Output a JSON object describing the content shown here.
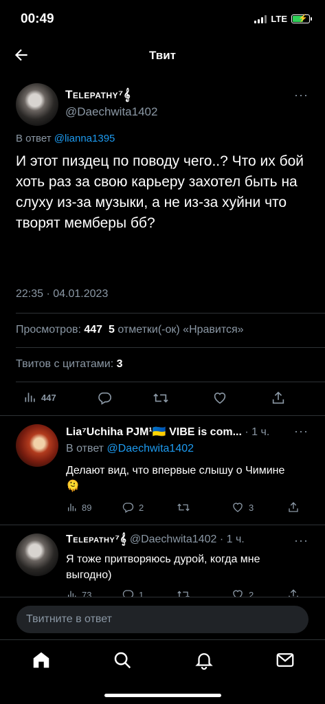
{
  "status_bar": {
    "time": "00:49",
    "network": "LTE"
  },
  "nav": {
    "title": "Твит"
  },
  "tweet": {
    "author_name": "Telepathy⁷𝄞",
    "author_handle": "@Daechwita1402",
    "reply_prefix": "В ответ",
    "reply_to": "@lianna1395",
    "text": "И этот пиздец по поводу чего..? Что их бой хоть раз за свою карьеру захотел быть на слуху из-за музыки, а не из-за хуйни что творят мемберы бб?",
    "timestamp": "22:35 · 04.01.2023",
    "views_label": "Просмотров:",
    "views_count": "447",
    "likes_count": "5",
    "likes_label": "отметки(-ок) «Нравится»",
    "quotes_label": "Твитов с цитатами:",
    "quotes_count": "3",
    "actions": {
      "views": "447"
    }
  },
  "replies": [
    {
      "author_name": "Lia⁷Uchiha PJM¹🇺🇦 VIBE is com...",
      "time": "· 1 ч.",
      "reply_prefix": "В ответ",
      "reply_to": "@Daechwita1402",
      "text": "Делают вид, что впервые слышу о Чимине 🫠",
      "views": "89",
      "replies": "2",
      "retweets": "",
      "likes": "3"
    },
    {
      "author_name": "Telepathy⁷𝄞",
      "author_handle": "@Daechwita1402",
      "time": "· 1 ч.",
      "text": "Я тоже притворяюсь дурой, когда мне выгодно)",
      "views": "73",
      "replies": "1",
      "retweets": "",
      "likes": "2"
    }
  ],
  "compose": {
    "placeholder": "Твитните в ответ"
  },
  "icons": {
    "back": "arrow-left-icon",
    "more": "more-dots-icon",
    "views": "bar-chart-icon",
    "reply": "speech-bubble-icon",
    "retweet": "retweet-icon",
    "like": "heart-icon",
    "share": "share-icon",
    "tab_home": "home-icon",
    "tab_search": "search-icon",
    "tab_notifications": "bell-icon",
    "tab_messages": "envelope-icon"
  },
  "colors": {
    "accent": "#1d9bf0",
    "muted": "#8b98a5",
    "background": "#000000",
    "battery": "#30d158"
  }
}
